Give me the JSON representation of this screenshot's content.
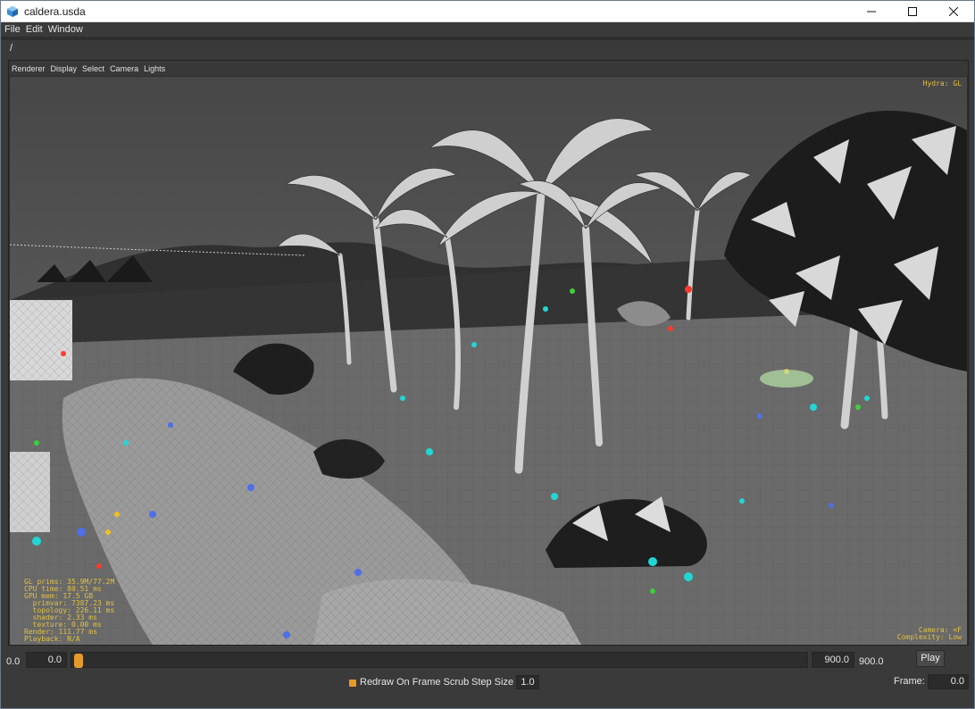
{
  "window": {
    "title": "caldera.usda"
  },
  "icons": {
    "app": "usd-view-icon",
    "minimize": "minimize-icon",
    "maximize": "maximize-icon",
    "close": "close-icon"
  },
  "menubar": {
    "items": [
      "File",
      "Edit",
      "Window"
    ]
  },
  "pathbar": {
    "path": "/"
  },
  "viewport_menu": {
    "items": [
      "Renderer",
      "Display",
      "Select",
      "Camera",
      "Lights"
    ]
  },
  "hud": {
    "top_right": "Hydra: GL",
    "bottom_right": [
      "Camera: <F",
      "Complexity: Low"
    ],
    "bottom_left": [
      "GL prims: 35.9M/77.2M",
      "CPU time: 80.51 ms",
      "GPU mem: 17.5 GB",
      "  primvar: 7387.23 ms",
      "  topology: 226.11 ms",
      "  shader: 2.33 ms",
      "  texture: 0.00 ms",
      "Render: 111.77 ms",
      "Playback: N/A"
    ]
  },
  "timeline": {
    "start_label": "0.0",
    "start_field": "0.0",
    "end_field": "900.0",
    "end_label": "900.0",
    "current_frame_fraction": 0.0,
    "play_label": "Play"
  },
  "bottom": {
    "redraw_label": "Redraw On Frame Scrub",
    "redraw_checked": true,
    "step_label": "Step Size",
    "step_value": "1.0",
    "frame_label": "Frame:",
    "frame_value": "0.0"
  },
  "colors": {
    "accent": "#e59a2a",
    "hud": "#e0c040"
  }
}
